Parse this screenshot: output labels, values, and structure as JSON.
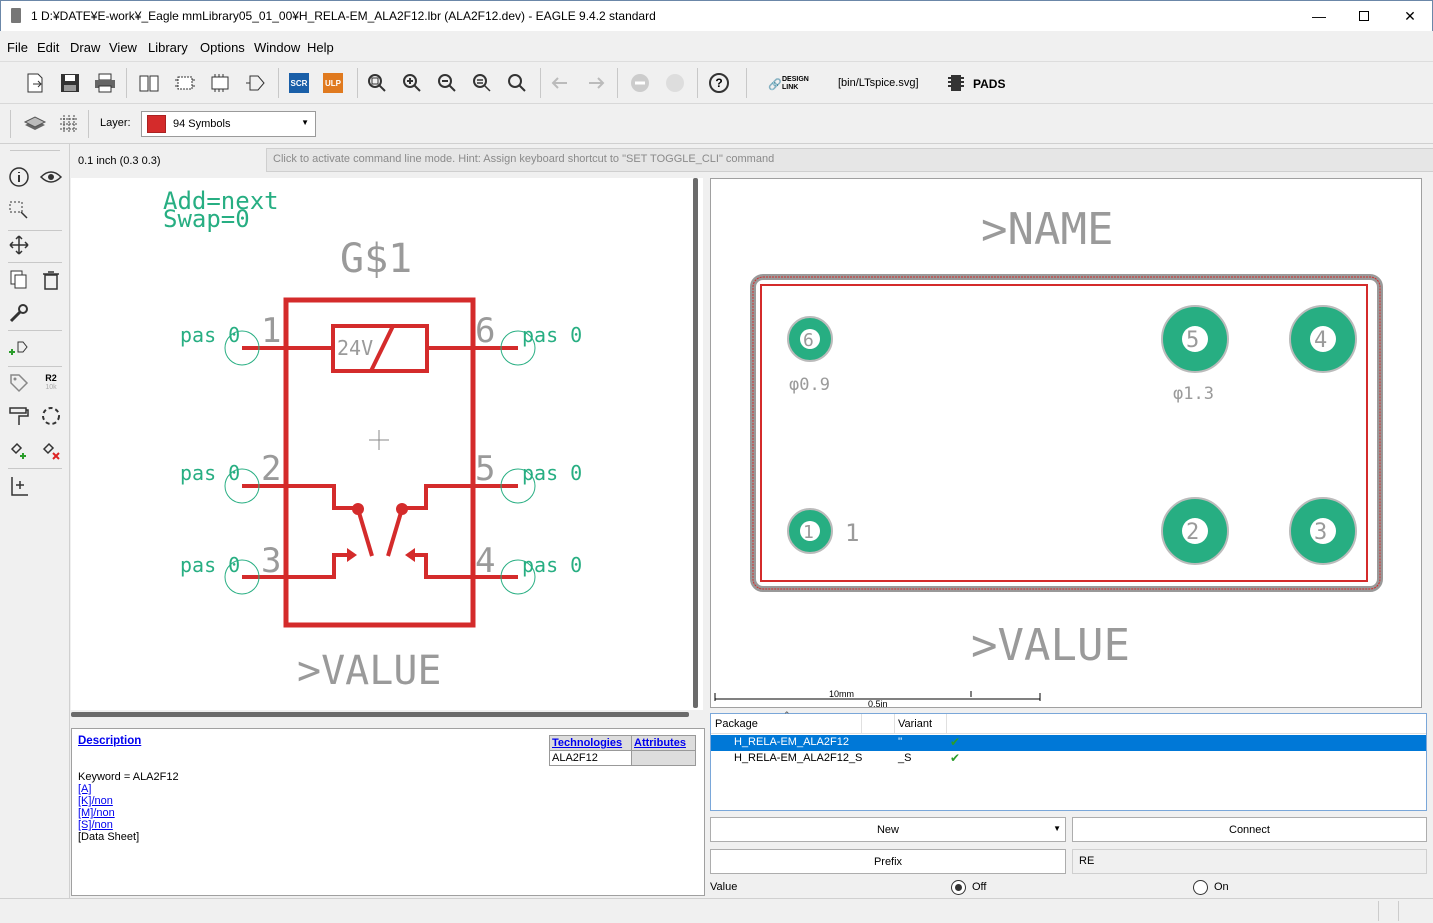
{
  "window": {
    "title": "1 D:¥DATE¥E-work¥_Eagle mmLibrary05_01_00¥H_RELA-EM_ALA2F12.lbr (ALA2F12.dev) - EAGLE 9.4.2 standard",
    "min_icon": "minimize-icon",
    "max_icon": "maximize-icon",
    "close_icon": "close-icon"
  },
  "menu": [
    "File",
    "Edit",
    "Draw",
    "View",
    "Library",
    "Options",
    "Window",
    "Help"
  ],
  "toolbar": {
    "scr_label": "SCR",
    "ulp_label": "ULP",
    "design_link_1": "DESIGN",
    "design_link_2": "LINK",
    "ltspice_label": "[bin/LTspice.svg]",
    "pads_label": "PADS",
    "help_label": "?"
  },
  "layer": {
    "label": "Layer:",
    "value": "94 Symbols",
    "color": "#d42b2b"
  },
  "grid_info": "0.1 inch (0.3 0.3)",
  "command": {
    "placeholder": "Click to activate command line mode. Hint: Assign keyboard shortcut to \"SET TOGGLE_CLI\" command"
  },
  "symbol": {
    "add": "Add=next",
    "swap": "Swap=0",
    "name": "G$1",
    "value": ">VALUE",
    "coil": "24V",
    "pin_labels": [
      "pas 0",
      "pas 0",
      "pas 0",
      "pas 0",
      "pas 0",
      "pas 0"
    ],
    "pin_nums": [
      "1",
      "2",
      "3",
      "6",
      "5",
      "4"
    ]
  },
  "package": {
    "name": ">NAME",
    "value": ">VALUE",
    "pads": [
      "6",
      "5",
      "4",
      "1",
      "2",
      "3"
    ],
    "pin1": "1",
    "hole_small": "φ0.9",
    "hole_large": "φ1.3",
    "scale_mm": "10mm",
    "scale_in": "0.5in"
  },
  "description": {
    "link": "Description",
    "keyword": "Keyword = ALA2F12",
    "items": [
      "[A]",
      "[K]/non",
      "[M]/non",
      "[S]/non"
    ],
    "datasheet": "[Data Sheet]",
    "tech_header": "Technologies",
    "attr_header": "Attributes",
    "tech_value": "ALA2F12",
    "attr_value": ""
  },
  "packages_table": {
    "col_package": "Package",
    "col_variant": "Variant",
    "rows": [
      {
        "package": "H_RELA-EM_ALA2F12",
        "variant": "''",
        "selected": true
      },
      {
        "package": "H_RELA-EM_ALA2F12_S",
        "variant": "_S",
        "selected": false
      }
    ]
  },
  "buttons": {
    "new": "New",
    "connect": "Connect",
    "prefix": "Prefix",
    "prefix_value": "RE"
  },
  "value_option": {
    "label": "Value",
    "off": "Off",
    "on": "On",
    "selected": "Off"
  }
}
